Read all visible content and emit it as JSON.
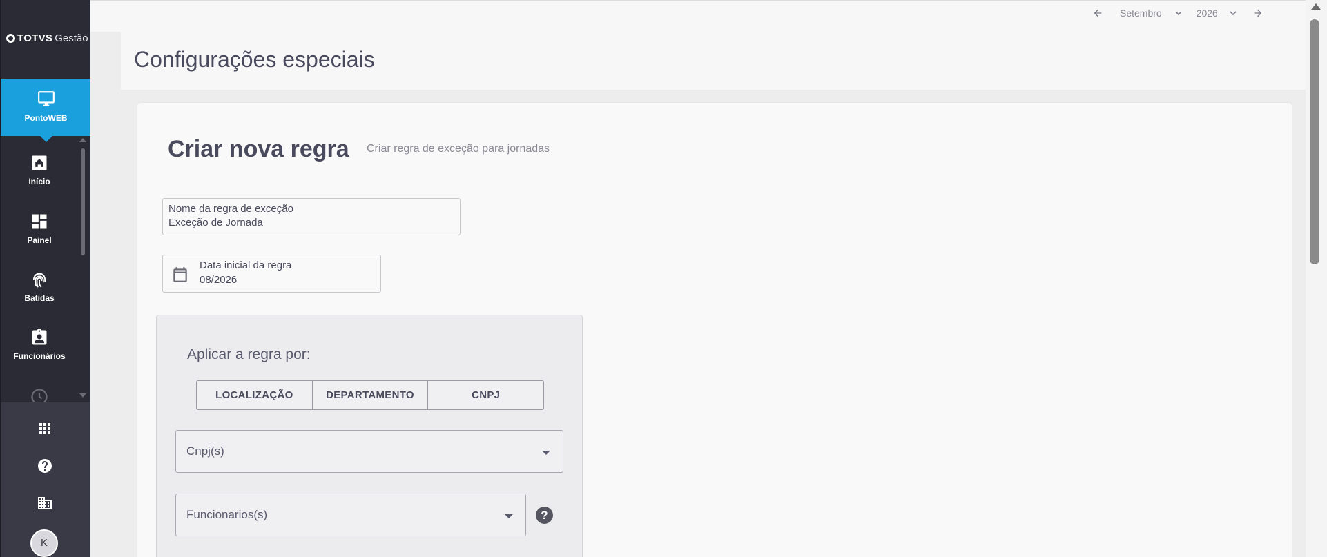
{
  "sidebar": {
    "logo": {
      "brand": "TOTVS",
      "product": "Gestão"
    },
    "active_module": {
      "label": "PontoWEB",
      "icon": "monitor-icon"
    },
    "items": [
      {
        "label": "Início",
        "icon": "home-icon"
      },
      {
        "label": "Painel",
        "icon": "dashboard-icon"
      },
      {
        "label": "Batidas",
        "icon": "fingerprint-icon"
      },
      {
        "label": "Funcionários",
        "icon": "badge-icon"
      },
      {
        "label": "",
        "icon": "clock-icon"
      }
    ],
    "bottom": [
      {
        "icon": "apps-grid-icon"
      },
      {
        "icon": "help-circle-icon"
      },
      {
        "icon": "building-icon"
      }
    ],
    "avatar": "K"
  },
  "topbar": {
    "month": "Setembro",
    "year": "2026"
  },
  "page": {
    "title": "Configurações especiais"
  },
  "form": {
    "title": "Criar nova regra",
    "subtitle": "Criar regra de exceção para jornadas",
    "rule_name": {
      "label": "Nome da regra de exceção",
      "value": "Exceção de Jornada"
    },
    "start_date": {
      "label": "Data inicial da regra",
      "value": "08/2026"
    },
    "apply_by": {
      "title": "Aplicar a regra por:",
      "options": [
        "LOCALIZAÇÃO",
        "DEPARTAMENTO",
        "CNPJ"
      ]
    },
    "cnpj_select": {
      "placeholder": "Cnpj(s)"
    },
    "employees_select": {
      "placeholder": "Funcionarios(s)"
    },
    "help": "?"
  },
  "colors": {
    "sidebar": "#2b2b35",
    "accent": "#1aa0dc",
    "sidebar_bottom": "#3a3a46"
  }
}
